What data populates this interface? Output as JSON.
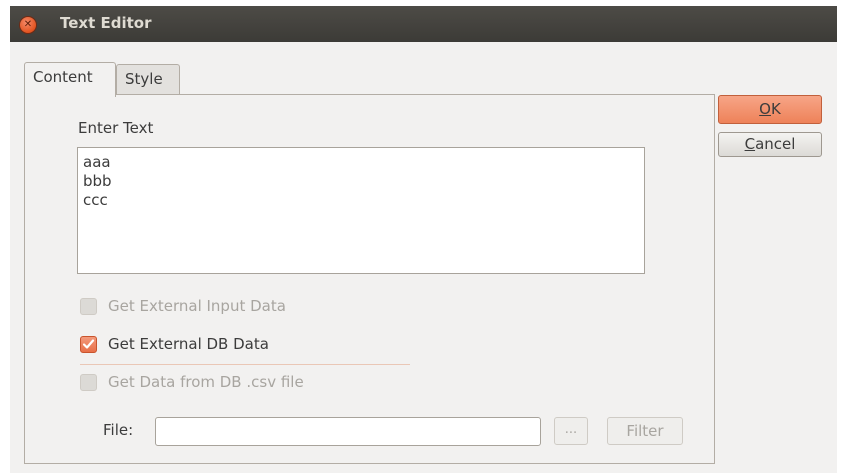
{
  "window": {
    "title": "Text Editor"
  },
  "tabs": {
    "content_label": "Content",
    "style_label": "Style"
  },
  "content": {
    "enter_text_label": "Enter Text",
    "text_value": "aaa\nbbb\nccc",
    "checkboxes": [
      {
        "label": "Get External Input Data",
        "checked": false,
        "enabled": false
      },
      {
        "label": "Get External DB Data",
        "checked": true,
        "enabled": true
      },
      {
        "label": "Get Data from DB .csv file",
        "checked": false,
        "enabled": false
      }
    ],
    "file_label": "File:",
    "file_value": "",
    "browse_label": "...",
    "filter_label": "Filter"
  },
  "buttons": {
    "ok_mnemonic": "O",
    "ok_rest": "K",
    "cancel_mnemonic": "C",
    "cancel_rest": "ancel"
  },
  "colors": {
    "accent": "#ee8259",
    "titlebar": "#3c3b37"
  }
}
